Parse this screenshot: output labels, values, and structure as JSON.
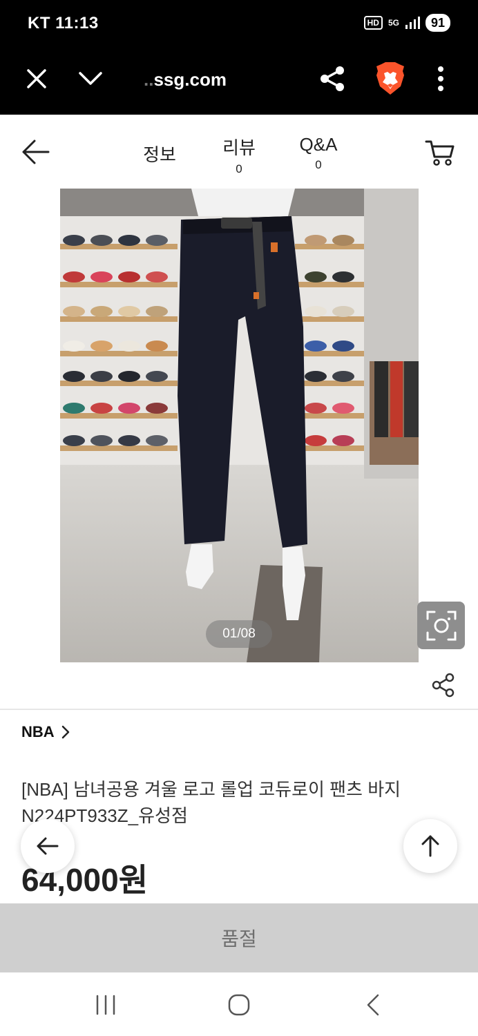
{
  "status_bar": {
    "carrier": "KT",
    "time": "11:13",
    "hd": "HD",
    "network": "5G",
    "battery": "91"
  },
  "browser": {
    "url_faded": "..",
    "url": "ssg.com",
    "icons": [
      "close-icon",
      "chevron-down-icon",
      "share-icon",
      "brave-lion-icon",
      "more-vertical-icon"
    ]
  },
  "header": {
    "tabs": [
      {
        "label": "정보",
        "count": ""
      },
      {
        "label": "리뷰",
        "count": "0"
      },
      {
        "label": "Q&A",
        "count": "0"
      }
    ]
  },
  "product": {
    "image_counter": "01/08",
    "brand": "NBA",
    "title": "[NBA] 남녀공용 겨울 로고 롤업 코듀로이 팬츠 바지 N224PT933Z_유성점",
    "price": "64,000원"
  },
  "actions": {
    "soldout_label": "품절"
  },
  "colors": {
    "status_bg": "#000000",
    "soldout_bg": "#cfcfcf",
    "soldout_text": "#6e6e6e",
    "brave_orange": "#fb542b"
  }
}
